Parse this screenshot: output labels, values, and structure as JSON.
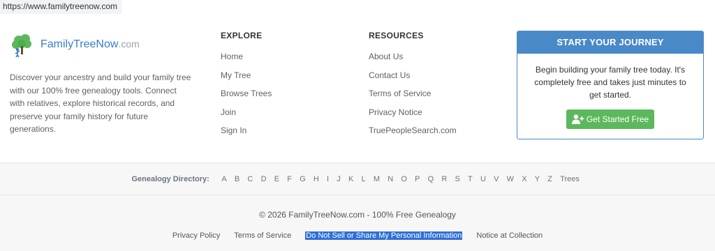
{
  "browser": {
    "url": "https://www.familytreenow.com"
  },
  "brand": {
    "name_part1": "FamilyTree",
    "name_part2": "Now",
    "name_suffix": ".com",
    "description": "Discover your ancestry and build your family tree with our 100% free genealogy tools. Connect with relatives, explore historical records, and preserve your family history for future generations."
  },
  "explore": {
    "title": "EXPLORE",
    "links": [
      "Home",
      "My Tree",
      "Browse Trees",
      "Join",
      "Sign In"
    ]
  },
  "resources": {
    "title": "RESOURCES",
    "links": [
      "About Us",
      "Contact Us",
      "Terms of Service",
      "Privacy Notice",
      "TruePeopleSearch.com"
    ]
  },
  "journey": {
    "title": "START YOUR JOURNEY",
    "text": "Begin building your family tree today. It's completely free and takes just minutes to get started.",
    "button_label": "Get Started Free",
    "button_icon": "user-plus-icon"
  },
  "directory": {
    "label": "Genealogy Directory:",
    "letters": [
      "A",
      "B",
      "C",
      "D",
      "E",
      "F",
      "G",
      "H",
      "I",
      "J",
      "K",
      "L",
      "M",
      "N",
      "O",
      "P",
      "Q",
      "R",
      "S",
      "T",
      "U",
      "V",
      "W",
      "X",
      "Y",
      "Z",
      "Trees"
    ]
  },
  "footer": {
    "copyright": "© 2026 FamilyTreeNow.com - 100% Free Genealogy",
    "links": [
      "Privacy Policy",
      "Terms of Service",
      "Do Not Sell or Share My Personal Information",
      "Notice at Collection"
    ]
  },
  "colors": {
    "primary": "#4a89c8",
    "success": "#5cb85c",
    "selection": "#2f6fd6"
  }
}
